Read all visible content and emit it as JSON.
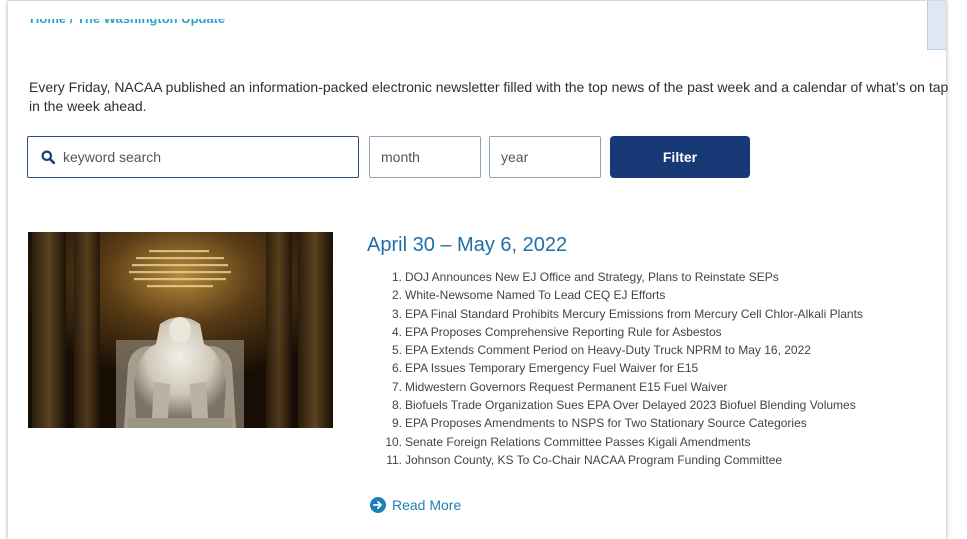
{
  "breadcrumb": {
    "text": "Home / The Washington Update"
  },
  "intro": "Every Friday, NACAA published an information-packed electronic newsletter filled with the top news of the past week and a calendar of what’s on tap in the week ahead.",
  "filters": {
    "search_placeholder": "keyword search",
    "search_value": "",
    "month_value": "month",
    "year_value": "year",
    "filter_label": "Filter"
  },
  "issue": {
    "title": "April 30 – May 6, 2022",
    "image_icon": "lincoln-memorial-photo",
    "headlines": [
      {
        "num": "1.",
        "text": "DOJ Announces New EJ Office and Strategy, Plans to Reinstate SEPs"
      },
      {
        "num": "2.",
        "text": "White-Newsome Named To Lead CEQ EJ Efforts"
      },
      {
        "num": "3.",
        "text": "EPA Final Standard Prohibits Mercury Emissions from Mercury Cell Chlor-Alkali Plants"
      },
      {
        "num": "4.",
        "text": "EPA Proposes Comprehensive Reporting Rule for Asbestos"
      },
      {
        "num": "5.",
        "text": "EPA Extends Comment Period on Heavy-Duty Truck NPRM to May 16, 2022"
      },
      {
        "num": "6.",
        "text": "EPA Issues Temporary Emergency Fuel Waiver for E15"
      },
      {
        "num": "7.",
        "text": "Midwestern Governors Request Permanent E15 Fuel Waiver"
      },
      {
        "num": "8.",
        "text": "Biofuels Trade Organization Sues EPA Over Delayed 2023 Biofuel Blending Volumes"
      },
      {
        "num": "9.",
        "text": "EPA Proposes Amendments to NSPS for Two Stationary Source Categories"
      },
      {
        "num": "10.",
        "text": "Senate Foreign Relations Committee Passes Kigali Amendments"
      },
      {
        "num": "11.",
        "text": "Johnson County, KS To Co-Chair NACAA Program Funding Committee"
      }
    ],
    "read_more_label": "Read More"
  },
  "colors": {
    "accent": "#1f6ea8",
    "button": "#173a76",
    "breadcrumb": "#29a3cc"
  }
}
